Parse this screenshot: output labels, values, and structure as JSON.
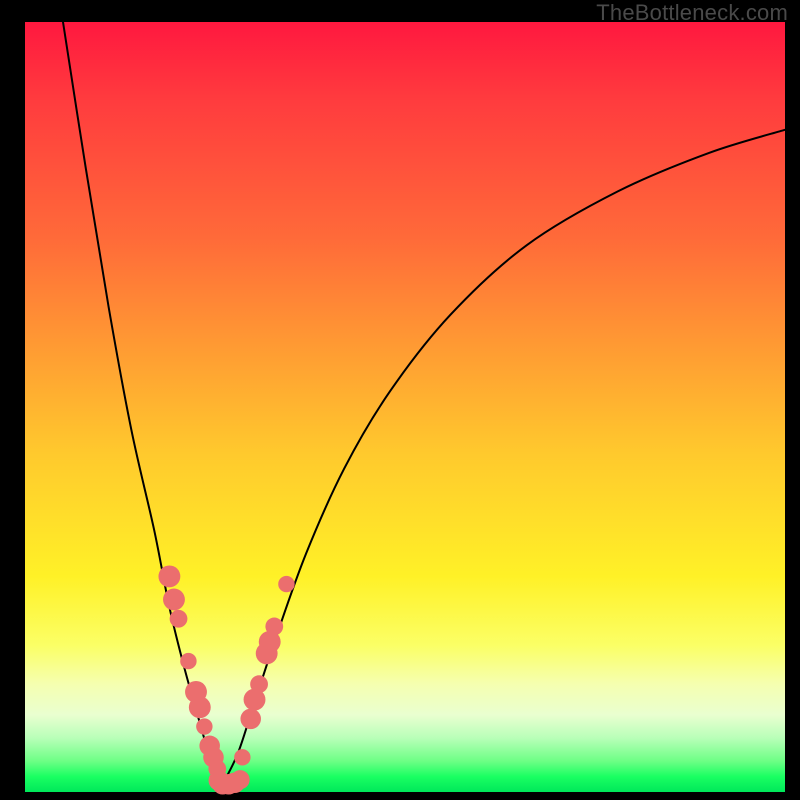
{
  "watermark": "TheBottleneck.com",
  "colors": {
    "bead": "#eb6e6e",
    "curve": "#000000",
    "frame": "#000000"
  },
  "chart_data": {
    "type": "line",
    "title": "",
    "xlabel": "",
    "ylabel": "",
    "xlim": [
      0,
      100
    ],
    "ylim": [
      0,
      100
    ],
    "grid": false,
    "legend": false,
    "note": "Bottleneck / mismatch curve. Y = mismatch % (0 at bottom = ideal). Left branch descends steeply to a minimum near x≈26, right branch rises with diminishing slope. Values are estimated from pixel positions; no axis ticks are rendered.",
    "series": [
      {
        "name": "left-branch",
        "x": [
          5,
          8,
          11,
          14,
          17,
          19,
          21,
          23,
          24.5,
          26
        ],
        "y": [
          100,
          81,
          63,
          47,
          34,
          24,
          16,
          9,
          4,
          1
        ]
      },
      {
        "name": "right-branch",
        "x": [
          26,
          28,
          30,
          33,
          37,
          42,
          48,
          56,
          66,
          78,
          90,
          100
        ],
        "y": [
          1,
          5,
          11,
          20,
          31,
          42,
          52,
          62,
          71,
          78,
          83,
          86
        ]
      }
    ],
    "highlight_points": {
      "name": "sample-beads",
      "note": "Pink circular markers clustered near the valley on both branches; approximate positions.",
      "points": [
        {
          "x": 19.0,
          "y": 28.0,
          "r": 1.6
        },
        {
          "x": 19.6,
          "y": 25.0,
          "r": 1.6
        },
        {
          "x": 20.2,
          "y": 22.5,
          "r": 1.3
        },
        {
          "x": 21.5,
          "y": 17.0,
          "r": 1.2
        },
        {
          "x": 22.5,
          "y": 13.0,
          "r": 1.6
        },
        {
          "x": 23.0,
          "y": 11.0,
          "r": 1.6
        },
        {
          "x": 23.6,
          "y": 8.5,
          "r": 1.2
        },
        {
          "x": 24.3,
          "y": 6.0,
          "r": 1.5
        },
        {
          "x": 24.8,
          "y": 4.5,
          "r": 1.5
        },
        {
          "x": 25.3,
          "y": 3.0,
          "r": 1.3
        },
        {
          "x": 25.5,
          "y": 1.5,
          "r": 1.5
        },
        {
          "x": 26.0,
          "y": 1.0,
          "r": 1.5
        },
        {
          "x": 26.8,
          "y": 1.0,
          "r": 1.5
        },
        {
          "x": 27.6,
          "y": 1.2,
          "r": 1.5
        },
        {
          "x": 28.3,
          "y": 1.6,
          "r": 1.4
        },
        {
          "x": 28.6,
          "y": 4.5,
          "r": 1.2
        },
        {
          "x": 29.7,
          "y": 9.5,
          "r": 1.5
        },
        {
          "x": 30.2,
          "y": 12.0,
          "r": 1.6
        },
        {
          "x": 30.8,
          "y": 14.0,
          "r": 1.3
        },
        {
          "x": 31.8,
          "y": 18.0,
          "r": 1.6
        },
        {
          "x": 32.2,
          "y": 19.5,
          "r": 1.6
        },
        {
          "x": 32.8,
          "y": 21.5,
          "r": 1.3
        },
        {
          "x": 34.4,
          "y": 27.0,
          "r": 1.2
        }
      ]
    }
  }
}
